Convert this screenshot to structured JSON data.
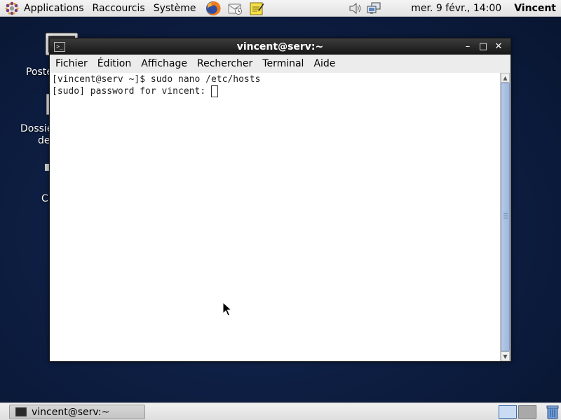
{
  "top_panel": {
    "menus": [
      "Applications",
      "Raccourcis",
      "Système"
    ],
    "launchers": [
      "firefox-icon",
      "mail-icon",
      "notes-icon"
    ],
    "tray": [
      "volume-icon",
      "network-icon"
    ],
    "clock": "mer.  9 févr., 14:00",
    "user": "Vincent"
  },
  "desktop": {
    "icons": [
      {
        "label": "Poste"
      },
      {
        "label": "Dossie"
      },
      {
        "label": "de"
      },
      {
        "label": "C"
      }
    ]
  },
  "window": {
    "title": "vincent@serv:~",
    "menubar": [
      "Fichier",
      "Édition",
      "Affichage",
      "Rechercher",
      "Terminal",
      "Aide"
    ],
    "controls": {
      "minimize": "–",
      "maximize": "□",
      "close": "✕"
    },
    "terminal_lines": [
      "[vincent@serv ~]$ sudo nano /etc/hosts",
      "[sudo] password for vincent: "
    ]
  },
  "taskbar": {
    "task_label": "vincent@serv:~"
  },
  "colors": {
    "desktop_bg": "#0e1f44",
    "panel_bg": "#e8e8e8",
    "titlebar_bg": "#262626",
    "scroll_thumb": "#9db6dc"
  }
}
